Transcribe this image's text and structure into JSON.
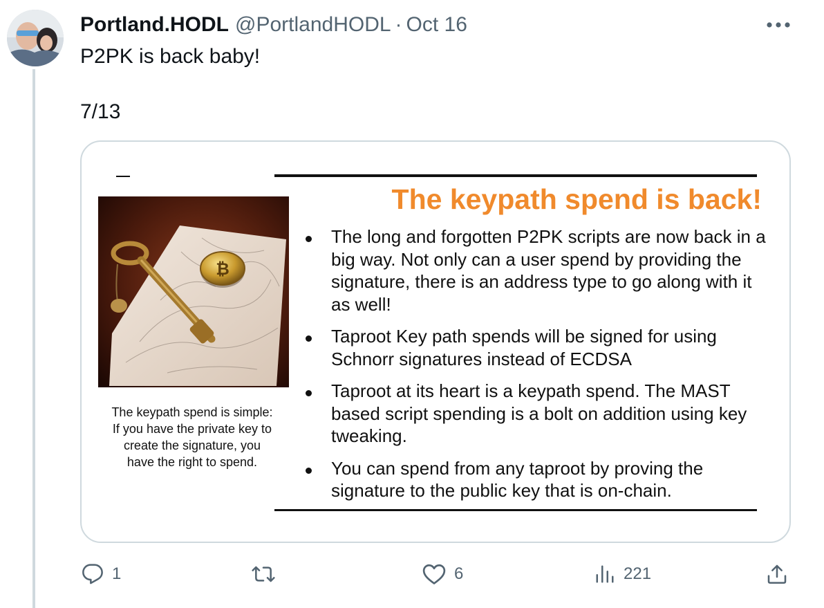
{
  "tweet": {
    "display_name": "Portland.HODL",
    "handle": "@PortlandHODL",
    "separator": "·",
    "date": "Oct 16",
    "more_label": "More",
    "text_line1": "P2PK is back baby!",
    "text_line2": "7/13"
  },
  "media": {
    "title": "The keypath spend is back!",
    "caption": "The keypath spend is simple: If you have the private key to create the signature, you have the right to spend.",
    "bullets": [
      "The long and forgotten P2PK scripts are now back in a big way. Not only can a user spend by providing the signature, there is an address type to go along with it as well!",
      "Taproot Key path spends will be signed for using Schnorr signatures instead of ECDSA",
      "Taproot at its heart is a keypath spend. The MAST based script spending is a bolt on addition using key tweaking.",
      "You can spend from any taproot by proving the signature to the public key that is on-chain."
    ],
    "photo_icon": "bitcoin-coin-and-golden-key-on-map-photo"
  },
  "actions": {
    "reply": {
      "icon": "reply-icon",
      "count": "1"
    },
    "retweet": {
      "icon": "retweet-icon",
      "count": ""
    },
    "like": {
      "icon": "heart-icon",
      "count": "6"
    },
    "views": {
      "icon": "views-icon",
      "count": "221"
    },
    "share": {
      "icon": "share-icon"
    }
  },
  "colors": {
    "text": "#0f1419",
    "secondary": "#536471",
    "border": "#cfd9de",
    "slide_title": "#f08a2c"
  }
}
